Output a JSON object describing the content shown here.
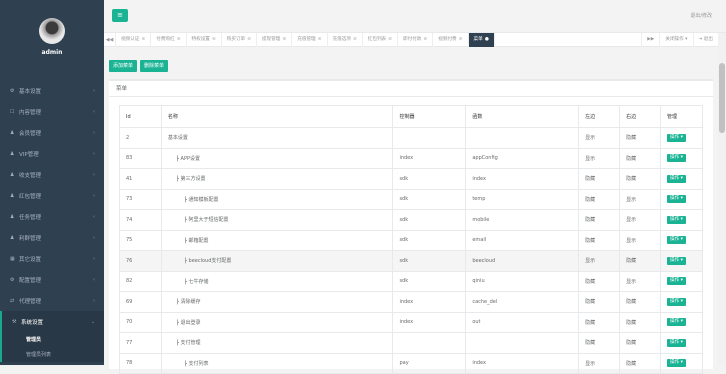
{
  "sidebar": {
    "username": "admin",
    "items": [
      {
        "icon": "gear-icon",
        "glyph": "⚙",
        "label": "基本设置"
      },
      {
        "icon": "doc-icon",
        "glyph": "☐",
        "label": "内容管理"
      },
      {
        "icon": "user-icon",
        "glyph": "♟",
        "label": "会员管理"
      },
      {
        "icon": "user-icon",
        "glyph": "♟",
        "label": "VIP管理"
      },
      {
        "icon": "user-icon",
        "glyph": "♟",
        "label": "收支管理"
      },
      {
        "icon": "user-icon",
        "glyph": "♟",
        "label": "红包管理"
      },
      {
        "icon": "user-icon",
        "glyph": "♟",
        "label": "任务管理"
      },
      {
        "icon": "user-icon",
        "glyph": "♟",
        "label": "利群管理"
      },
      {
        "icon": "grid-icon",
        "glyph": "▦",
        "label": "其它设置"
      },
      {
        "icon": "gear-icon",
        "glyph": "⚙",
        "label": "配置管理"
      },
      {
        "icon": "swap-icon",
        "glyph": "⇄",
        "label": "代理管理"
      },
      {
        "icon": "wrench-icon",
        "glyph": "⚒",
        "label": "系统设置"
      }
    ],
    "submenu": [
      "管理员",
      "管理员列表"
    ]
  },
  "topbar": {
    "menu_glyph": "≡",
    "welcome": "退出/修改"
  },
  "tabs": [
    {
      "label": "视频认证"
    },
    {
      "label": "付费购红"
    },
    {
      "label": "特权设置"
    },
    {
      "label": "购买订单"
    },
    {
      "label": "提现管理"
    },
    {
      "label": "充值管理"
    },
    {
      "label": "充值选项"
    },
    {
      "label": "红包列表"
    },
    {
      "label": "即付付款"
    },
    {
      "label": "视频付费"
    },
    {
      "label": "菜单",
      "active": true
    }
  ],
  "tabbar": {
    "prev": "◀◀",
    "next": "▶▶",
    "close_label": "关闭操作 ▾",
    "logout_label": "⇥ 退出"
  },
  "toolbar": {
    "add_label": "添加菜单",
    "delete_label": "删除菜单"
  },
  "panel": {
    "title": "菜单"
  },
  "table": {
    "headers": [
      "Id",
      "名称",
      "控制器",
      "函数",
      "左边",
      "右边",
      "管理"
    ],
    "op_label": "操作 ▾",
    "rows": [
      {
        "id": "2",
        "indent": 0,
        "name": "基本设置",
        "controller": "",
        "func": "",
        "left": "显示",
        "right": "隐藏"
      },
      {
        "id": "83",
        "indent": 1,
        "name": "APP设置",
        "controller": "index",
        "func": "appConfig",
        "left": "显示",
        "right": "隐藏"
      },
      {
        "id": "41",
        "indent": 1,
        "name": "第三方设置",
        "controller": "sdk",
        "func": "index",
        "left": "隐藏",
        "right": "隐藏"
      },
      {
        "id": "73",
        "indent": 2,
        "name": "通知模板配置",
        "controller": "sdk",
        "func": "temp",
        "left": "隐藏",
        "right": "显示"
      },
      {
        "id": "74",
        "indent": 2,
        "name": "阿里大于短信配置",
        "controller": "sdk",
        "func": "mobile",
        "left": "隐藏",
        "right": "显示"
      },
      {
        "id": "75",
        "indent": 2,
        "name": "邮箱配置",
        "controller": "sdk",
        "func": "email",
        "left": "隐藏",
        "right": "显示"
      },
      {
        "id": "76",
        "indent": 2,
        "name": "beecloud支付配置",
        "controller": "sdk",
        "func": "beecloud",
        "left": "显示",
        "right": "隐藏",
        "highlight": true
      },
      {
        "id": "82",
        "indent": 2,
        "name": "七牛存储",
        "controller": "sdk",
        "func": "qiniu",
        "left": "隐藏",
        "right": "显示"
      },
      {
        "id": "69",
        "indent": 1,
        "name": "清除缓存",
        "controller": "index",
        "func": "cache_del",
        "left": "隐藏",
        "right": "隐藏"
      },
      {
        "id": "70",
        "indent": 1,
        "name": "退出登录",
        "controller": "index",
        "func": "out",
        "left": "隐藏",
        "right": "隐藏"
      },
      {
        "id": "77",
        "indent": 1,
        "name": "支付管理",
        "controller": "",
        "func": "",
        "left": "隐藏",
        "right": "隐藏"
      },
      {
        "id": "78",
        "indent": 2,
        "name": "支付列表",
        "controller": "pay",
        "func": "index",
        "left": "显示",
        "right": "隐藏"
      }
    ]
  }
}
